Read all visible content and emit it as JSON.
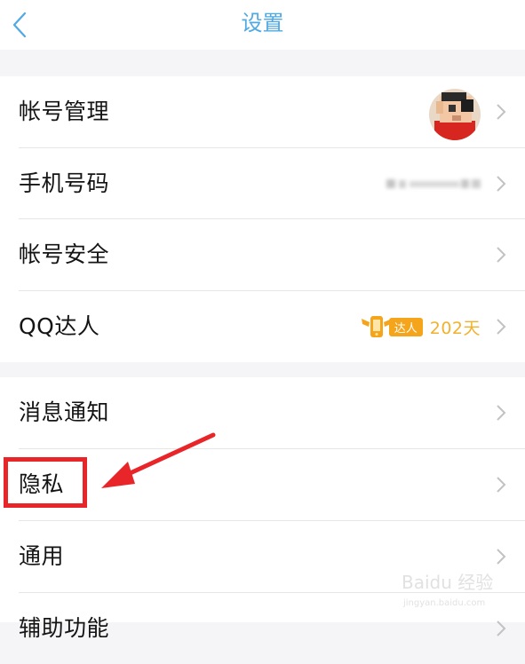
{
  "header": {
    "title": "设置",
    "back_icon": "chevron-left-icon",
    "accent_color": "#4fa9e3"
  },
  "account_group": {
    "rows": [
      {
        "label": "帐号管理",
        "trailing": "avatar"
      },
      {
        "label": "手机号码",
        "trailing": "masked-phone"
      },
      {
        "label": "帐号安全"
      },
      {
        "label": "QQ达人",
        "badge_text": "达人",
        "badge_days": "202天"
      }
    ]
  },
  "general_group": {
    "rows": [
      {
        "label": "消息通知"
      },
      {
        "label": "隐私"
      },
      {
        "label": "通用"
      },
      {
        "label": "辅助功能"
      }
    ]
  },
  "annotation": {
    "highlight_color": "#e8262a"
  },
  "watermark": {
    "brand": "Baidu 经验",
    "sub": "jingyan.baidu.com"
  }
}
